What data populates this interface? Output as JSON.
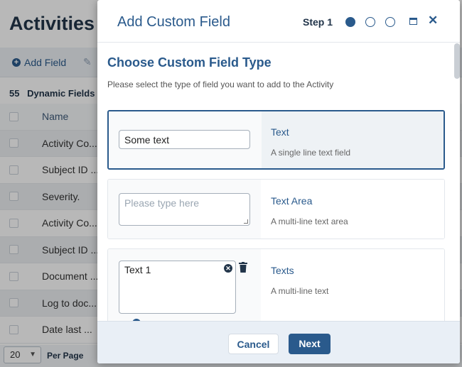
{
  "background": {
    "page_title": "Activities",
    "toolbar": {
      "add_field_label": "Add Field"
    },
    "fields_count": "55",
    "fields_label": "Dynamic Fields",
    "table": {
      "header": "Name",
      "rows": [
        "Activity Co...",
        "Subject ID ...",
        "Severity.",
        "Activity Co...",
        "Subject ID ...",
        "Document ...",
        "Log to doc...",
        "Date last ..."
      ]
    },
    "pagination": {
      "page_size": "20",
      "per_page_label": "Per Page"
    }
  },
  "modal": {
    "title": "Add Custom Field",
    "step_label": "Step 1",
    "steps": [
      {
        "active": true
      },
      {
        "active": false
      },
      {
        "active": false
      }
    ],
    "icons": {
      "maximize": "maximize-icon",
      "close": "close-icon"
    },
    "close_glyph": "✕",
    "heading": "Choose Custom Field Type",
    "description": "Please select the type of field you want to add to the Activity",
    "field_types": [
      {
        "name": "Text",
        "description": "A single line text field",
        "example_value": "Some text",
        "selected": true
      },
      {
        "name": "Text Area",
        "description": "A multi-line text area",
        "example_placeholder": "Please type here",
        "selected": false
      },
      {
        "name": "Texts",
        "description": "A multi-line text",
        "example_value": "Text 1",
        "selected": false
      }
    ],
    "footer": {
      "cancel_label": "Cancel",
      "next_label": "Next"
    }
  },
  "colors": {
    "primary": "#2a5a8c",
    "dark": "#22354a",
    "footer_bg": "#e9eff6"
  }
}
